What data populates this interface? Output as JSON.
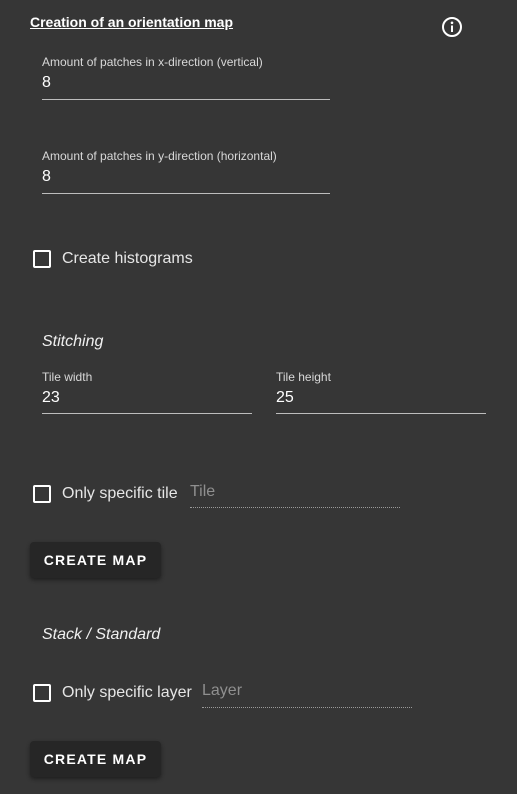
{
  "header": {
    "title": "Creation of an orientation map",
    "info_icon": "info-icon"
  },
  "patches_x": {
    "label": "Amount of patches in x-direction (vertical)",
    "value": "8"
  },
  "patches_y": {
    "label": "Amount of patches in y-direction (horizontal)",
    "value": "8"
  },
  "histograms": {
    "label": "Create histograms",
    "checked": false
  },
  "stitching": {
    "title": "Stitching",
    "tile_width": {
      "label": "Tile width",
      "value": "23"
    },
    "tile_height": {
      "label": "Tile height",
      "value": "25"
    },
    "specific_tile": {
      "label": "Only specific tile",
      "placeholder": "Tile",
      "checked": false
    },
    "button_label": "CREATE MAP"
  },
  "stack": {
    "title": "Stack / Standard",
    "specific_layer": {
      "label": "Only specific layer",
      "placeholder": "Layer",
      "checked": false
    },
    "button_label": "CREATE MAP"
  },
  "colors": {
    "background": "#363636",
    "button_background": "#262626",
    "text": "#ffffff"
  }
}
